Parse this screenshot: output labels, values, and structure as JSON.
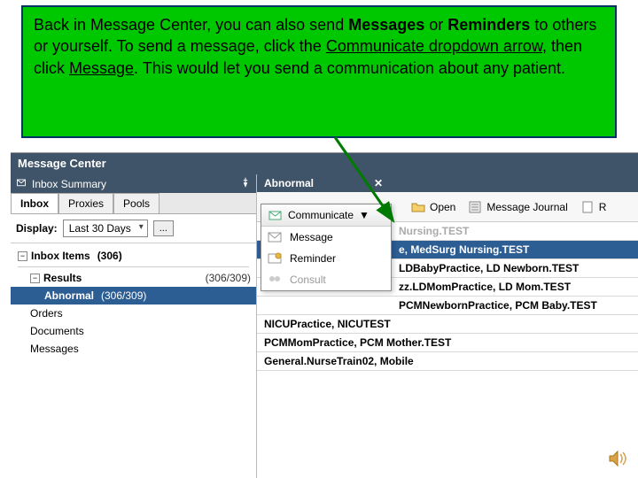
{
  "callout": {
    "p1a": "Back in Message Center, you can also send ",
    "p1b": "Messages",
    "p1c": " or ",
    "p1d": "Reminders",
    "p1e": " to others or yourself.  To send a message, click the ",
    "p1f": "Communicate dropdown arrow",
    "p1g": ", then click ",
    "p1h": "Message",
    "p1i": ".  This would let you send a communication about any patient."
  },
  "titlebar": "Message Center",
  "sidebar_header": "Inbox Summary",
  "tabs": {
    "inbox": "Inbox",
    "proxies": "Proxies",
    "pools": "Pools"
  },
  "display": {
    "label": "Display:",
    "value": "Last 30 Days",
    "ellipsis": "..."
  },
  "tree": {
    "inbox_items": "Inbox Items",
    "inbox_count": "(306)",
    "results": "Results",
    "results_count": "(306/309)",
    "abnormal": "Abnormal",
    "abnormal_count": "(306/309)",
    "orders": "Orders",
    "documents": "Documents",
    "messages": "Messages"
  },
  "main_header": "Abnormal",
  "toolbar": {
    "communicate": "Communicate",
    "open": "Open",
    "message_journal": "Message Journal",
    "r_partial": "R"
  },
  "menu": {
    "message": "Message",
    "reminder": "Reminder",
    "consult": "Consult"
  },
  "list": [
    "e, MedSurg Nursing.TEST",
    "LDBabyPractice, LD Newborn.TEST",
    "zz.LDMomPractice, LD Mom.TEST",
    "PCMNewbornPractice, PCM Baby.TEST",
    "NICUPractice, NICUTEST",
    "PCMMomPractice, PCM Mother.TEST",
    "General.NurseTrain02, Mobile"
  ]
}
